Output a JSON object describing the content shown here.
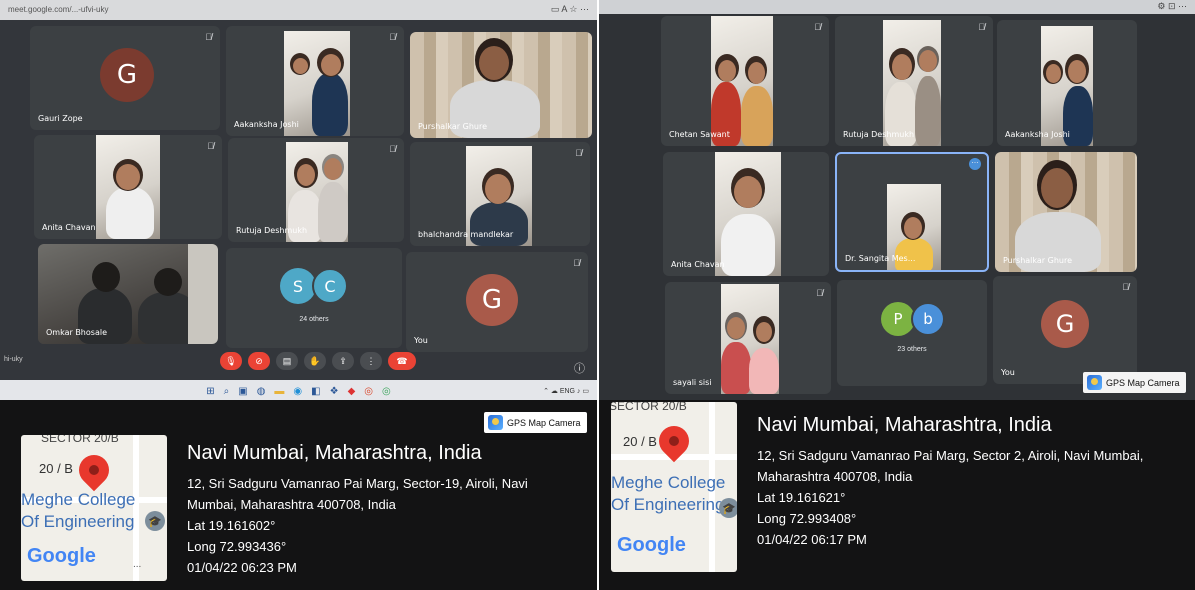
{
  "left": {
    "browser_url": "meet.google.com/...-ufvi-uky",
    "tiles": [
      {
        "name": "Gauri Zope",
        "avatar_letter": "G",
        "avatar_color": "#7b3b2f"
      },
      {
        "name": "Aakanksha Joshi"
      },
      {
        "name": "Purshalkar Ghure"
      },
      {
        "name": "Anita Chavan"
      },
      {
        "name": "Rutuja Deshmukh"
      },
      {
        "name": "bhalchandra mandlekar"
      },
      {
        "name": "Omkar Bhosale"
      },
      {
        "name": "24 others",
        "avatar_letters": [
          "S",
          "C"
        ],
        "avatar_colors": [
          "#4ea8c7",
          "#4ea8c7"
        ]
      },
      {
        "name": "You",
        "avatar_letter": "G",
        "avatar_color": "#a95a4a"
      }
    ],
    "meeting_code_fragment": "hi-uky",
    "gps_badge": "GPS Map Camera",
    "map": {
      "sector": "SECTOR 20/B",
      "plot": "20 / B",
      "college_line1": "Meghe College",
      "college_line2": "Of Engineering",
      "google": "Google"
    },
    "location": {
      "city": "Navi Mumbai, Maharashtra, India",
      "address_line1": "12, Sri Sadguru Vamanrao Pai Marg, Sector-19, Airoli, Navi",
      "address_line2": "Mumbai, Maharashtra 400708, India",
      "lat": "Lat 19.161602°",
      "long": "Long 72.993436°",
      "datetime": "01/04/22 06:23 PM"
    }
  },
  "right": {
    "tiles": [
      {
        "name": "Chetan Sawant"
      },
      {
        "name": "Rutuja Deshmukh"
      },
      {
        "name": "Aakanksha Joshi"
      },
      {
        "name": "Anita Chavan"
      },
      {
        "name": "Dr. Sangita Mes..."
      },
      {
        "name": "Purshalkar Ghure"
      },
      {
        "name": "sayali sisi"
      },
      {
        "name": "23 others",
        "avatar_letters": [
          "P",
          "b"
        ],
        "avatar_colors": [
          "#7cb342",
          "#4a90d9"
        ]
      },
      {
        "name": "You",
        "avatar_letter": "G",
        "avatar_color": "#a95a4a"
      }
    ],
    "gps_badge": "GPS Map Camera",
    "map": {
      "sector": "SECTOR 20/B",
      "plot": "20 / B",
      "college_line1": "Meghe College",
      "college_line2": "Of Engineering",
      "google": "Google"
    },
    "location": {
      "city": "Navi Mumbai, Maharashtra, India",
      "address_line1": "12, Sri Sadguru Vamanrao Pai Marg, Sector 2, Airoli, Navi Mumbai,",
      "address_line2": "Maharashtra 400708, India",
      "lat": "Lat 19.161621°",
      "long": "Long 72.993408°",
      "datetime": "01/04/22 06:17 PM"
    }
  },
  "icons": {
    "mic_off": "mic-off-icon",
    "cam_off": "camera-off-icon",
    "captions": "captions-icon",
    "raise_hand": "raise-hand-icon",
    "present": "present-icon",
    "more": "more-options-icon",
    "end_call": "end-call-icon"
  }
}
